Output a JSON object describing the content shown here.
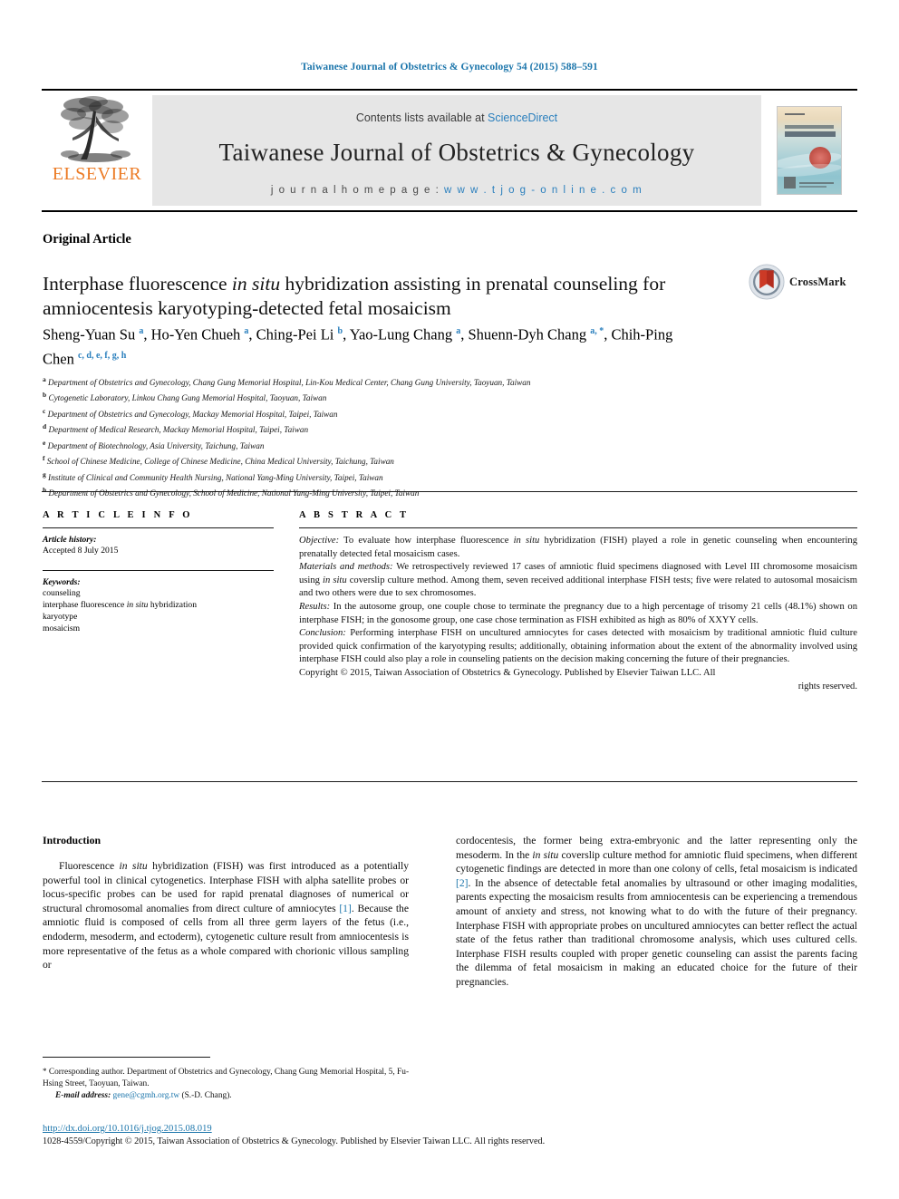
{
  "running_head": "Taiwanese Journal of Obstetrics & Gynecology 54 (2015) 588–591",
  "masthead": {
    "publisher_word": "ELSEVIER",
    "contents_prefix": "Contents lists available at ",
    "contents_link": "ScienceDirect",
    "journal_name": "Taiwanese Journal of Obstetrics & Gynecology",
    "homepage_prefix": "j o u r n a l   h o m e p a g e :  ",
    "homepage_url": "w w w . t j o g - o n l i n e . c o m",
    "cover_title_line1": "Taiwanese Journal of",
    "cover_title_line2": "Obstetrics & Gynecology"
  },
  "article": {
    "section_label": "Original Article",
    "title_line1_a": "Interphase fluorescence ",
    "title_line1_i": "in situ",
    "title_line1_b": " hybridization assisting in prenatal",
    "title_line2": "counseling for amniocentesis karyotyping-detected fetal mosaicism",
    "crossmark_label": "CrossMark",
    "authors_html": "Sheng-Yuan Su <sup>a</sup>, Ho-Yen Chueh <sup>a</sup>, Ching-Pei Li <sup>b</sup>, Yao-Lung Chang <sup>a</sup>, Shuenn-Dyh Chang <sup>a, *</sup>, Chih-Ping Chen <sup>c, d, e, f, g, h</sup>",
    "affiliations": [
      {
        "mark": "a",
        "text": "Department of Obstetrics and Gynecology, Chang Gung Memorial Hospital, Lin-Kou Medical Center, Chang Gung University, Taoyuan, Taiwan"
      },
      {
        "mark": "b",
        "text": "Cytogenetic Laboratory, Linkou Chang Gung Memorial Hospital, Taoyuan, Taiwan"
      },
      {
        "mark": "c",
        "text": "Department of Obstetrics and Gynecology, Mackay Memorial Hospital, Taipei, Taiwan"
      },
      {
        "mark": "d",
        "text": "Department of Medical Research, Mackay Memorial Hospital, Taipei, Taiwan"
      },
      {
        "mark": "e",
        "text": "Department of Biotechnology, Asia University, Taichung, Taiwan"
      },
      {
        "mark": "f",
        "text": "School of Chinese Medicine, College of Chinese Medicine, China Medical University, Taichung, Taiwan"
      },
      {
        "mark": "g",
        "text": "Institute of Clinical and Community Health Nursing, National Yang-Ming University, Taipei, Taiwan"
      },
      {
        "mark": "h",
        "text": "Department of Obstetrics and Gynecology, School of Medicine, National Yang-Ming University, Taipei, Taiwan"
      }
    ]
  },
  "article_info": {
    "heading": "A R T I C L E  I N F O",
    "history_label": "Article history:",
    "history_value": "Accepted 8 July 2015",
    "keywords_label": "Keywords:",
    "keywords": [
      "counseling",
      "interphase fluorescence in situ hybridization",
      "karyotype",
      "mosaicism"
    ]
  },
  "abstract": {
    "heading": "A B S T R A C T",
    "objective_label": "Objective:",
    "objective_text": " To evaluate how interphase fluorescence in situ hybridization (FISH) played a role in genetic counseling when encountering prenatally detected fetal mosaicism cases.",
    "methods_label": "Materials and methods:",
    "methods_text": " We retrospectively reviewed 17 cases of amniotic fluid specimens diagnosed with Level III chromosome mosaicism using in situ coverslip culture method. Among them, seven received additional interphase FISH tests; five were related to autosomal mosaicism and two others were due to sex chromosomes.",
    "results_label": "Results:",
    "results_text": " In the autosome group, one couple chose to terminate the pregnancy due to a high percentage of trisomy 21 cells (48.1%) shown on interphase FISH; in the gonosome group, one case chose termination as FISH exhibited as high as 80% of XXYY cells.",
    "conclusion_label": "Conclusion:",
    "conclusion_text": " Performing interphase FISH on uncultured amniocytes for cases detected with mosaicism by traditional amniotic fluid culture provided quick confirmation of the karyotyping results; additionally, obtaining information about the extent of the abnormality involved using interphase FISH could also play a role in counseling patients on the decision making concerning the future of their pregnancies.",
    "copyright_text": "Copyright © 2015, Taiwan Association of Obstetrics & Gynecology. Published by Elsevier Taiwan LLC. All",
    "copyright_last": "rights reserved."
  },
  "body": {
    "intro_heading": "Introduction",
    "left_para_1": "Fluorescence in situ hybridization (FISH) was first introduced as a potentially powerful tool in clinical cytogenetics. Interphase FISH with alpha satellite probes or locus-specific probes can be used for rapid prenatal diagnoses of numerical or structural chromosomal anomalies from direct culture of amniocytes ",
    "left_ref_1": "[1]",
    "left_para_1b": ". Because the amniotic fluid is composed of cells from all three germ layers of the fetus (i.e., endoderm, mesoderm, and ectoderm), cytogenetic culture result from amniocentesis is more representative of the fetus as a whole compared with chorionic villous sampling or",
    "right_para_1a": "cordocentesis, the former being extra-embryonic and the latter representing only the mesoderm. In the in situ coverslip culture method for amniotic fluid specimens, when different cytogenetic findings are detected in more than one colony of cells, fetal mosaicism is indicated ",
    "right_ref_1": "[2]",
    "right_para_1b": ". In the absence of detectable fetal anomalies by ultrasound or other imaging modalities, parents expecting the mosaicism results from amniocentesis can be experiencing a tremendous amount of anxiety and stress, not knowing what to do with the future of their pregnancy. Interphase FISH with appropriate probes on uncultured amniocytes can better reflect the actual state of the fetus rather than traditional chromosome analysis, which uses cultured cells. Interphase FISH results coupled with proper genetic counseling can assist the parents facing the dilemma of fetal mosaicism in making an educated choice for the future of their pregnancies."
  },
  "footer": {
    "corresponding_marker": "*",
    "corresponding_text": " Corresponding author. Department of Obstetrics and Gynecology, Chang Gung Memorial Hospital, 5, Fu-Hsing Street, Taoyuan, Taiwan.",
    "email_label": "E-mail address:",
    "email": "gene@cgmh.org.tw",
    "email_suffix": " (S.-D. Chang).",
    "doi": "http://dx.doi.org/10.1016/j.tjog.2015.08.019",
    "issn_line": "1028-4559/Copyright © 2015, Taiwan Association of Obstetrics & Gynecology. Published by Elsevier Taiwan LLC. All rights reserved."
  },
  "colors": {
    "link_blue": "#1b75ab",
    "sciencedirect_blue": "#2a7fbd",
    "elsevier_orange": "#ec7b25"
  }
}
